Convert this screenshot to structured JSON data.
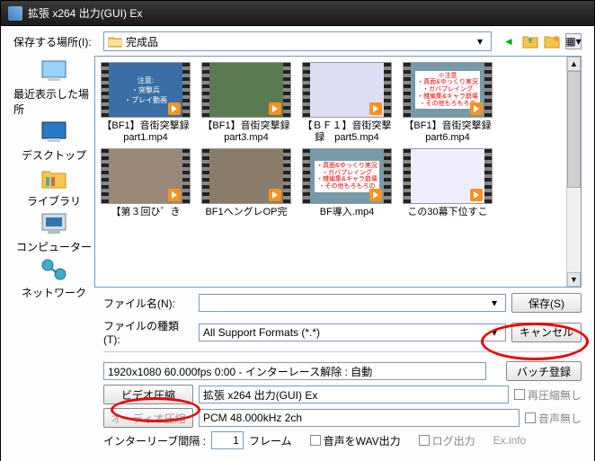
{
  "window": {
    "title": "拡張 x264 出力(GUI) Ex"
  },
  "location": {
    "label": "保存する場所(I):",
    "value": "完成品"
  },
  "places": {
    "recent": "最近表示した場所",
    "desktop": "デスクトップ",
    "library": "ライブラリ",
    "computer": "コンピューター",
    "network": "ネットワーク"
  },
  "files": [
    {
      "name": "【BF1】音街突撃録　part1.mp4"
    },
    {
      "name": "【BF1】音街突撃録　part3.mp4"
    },
    {
      "name": "【ＢＦ１】音街突撃録　part5.mp4"
    },
    {
      "name": "【BF1】音街突撃録　part6.mp4"
    },
    {
      "name": "【第３回ひ゛き"
    },
    {
      "name": "BF1ヘングレOP完"
    },
    {
      "name": "BF導入.mp4"
    },
    {
      "name": "この30幕下位すこ"
    }
  ],
  "filename": {
    "label": "ファイル名(N):",
    "value": ""
  },
  "filetype": {
    "label": "ファイルの種類(T):",
    "value": "All Support Formats (*.*)"
  },
  "buttons": {
    "save": "保存(S)",
    "cancel": "キャンセル",
    "batch": "バッチ登録"
  },
  "info": {
    "res": "1920x1080  60.000fps  0:00  -  インターレース解除 : 自動"
  },
  "video": {
    "btn": "ビデオ圧縮",
    "codec": "拡張 x264 出力(GUI) Ex",
    "norecomp": "再圧縮無し"
  },
  "audio": {
    "btn": "オーディオ圧縮",
    "codec": "PCM 48.000kHz 2ch",
    "noaudio": "音声無し"
  },
  "interleave": {
    "label": "インターリーブ間隔 :",
    "frames_value": "1",
    "frames_label": "フレーム",
    "wav": "音声をWAV出力",
    "log": "ログ出力",
    "exinfo": "Ex.info"
  }
}
